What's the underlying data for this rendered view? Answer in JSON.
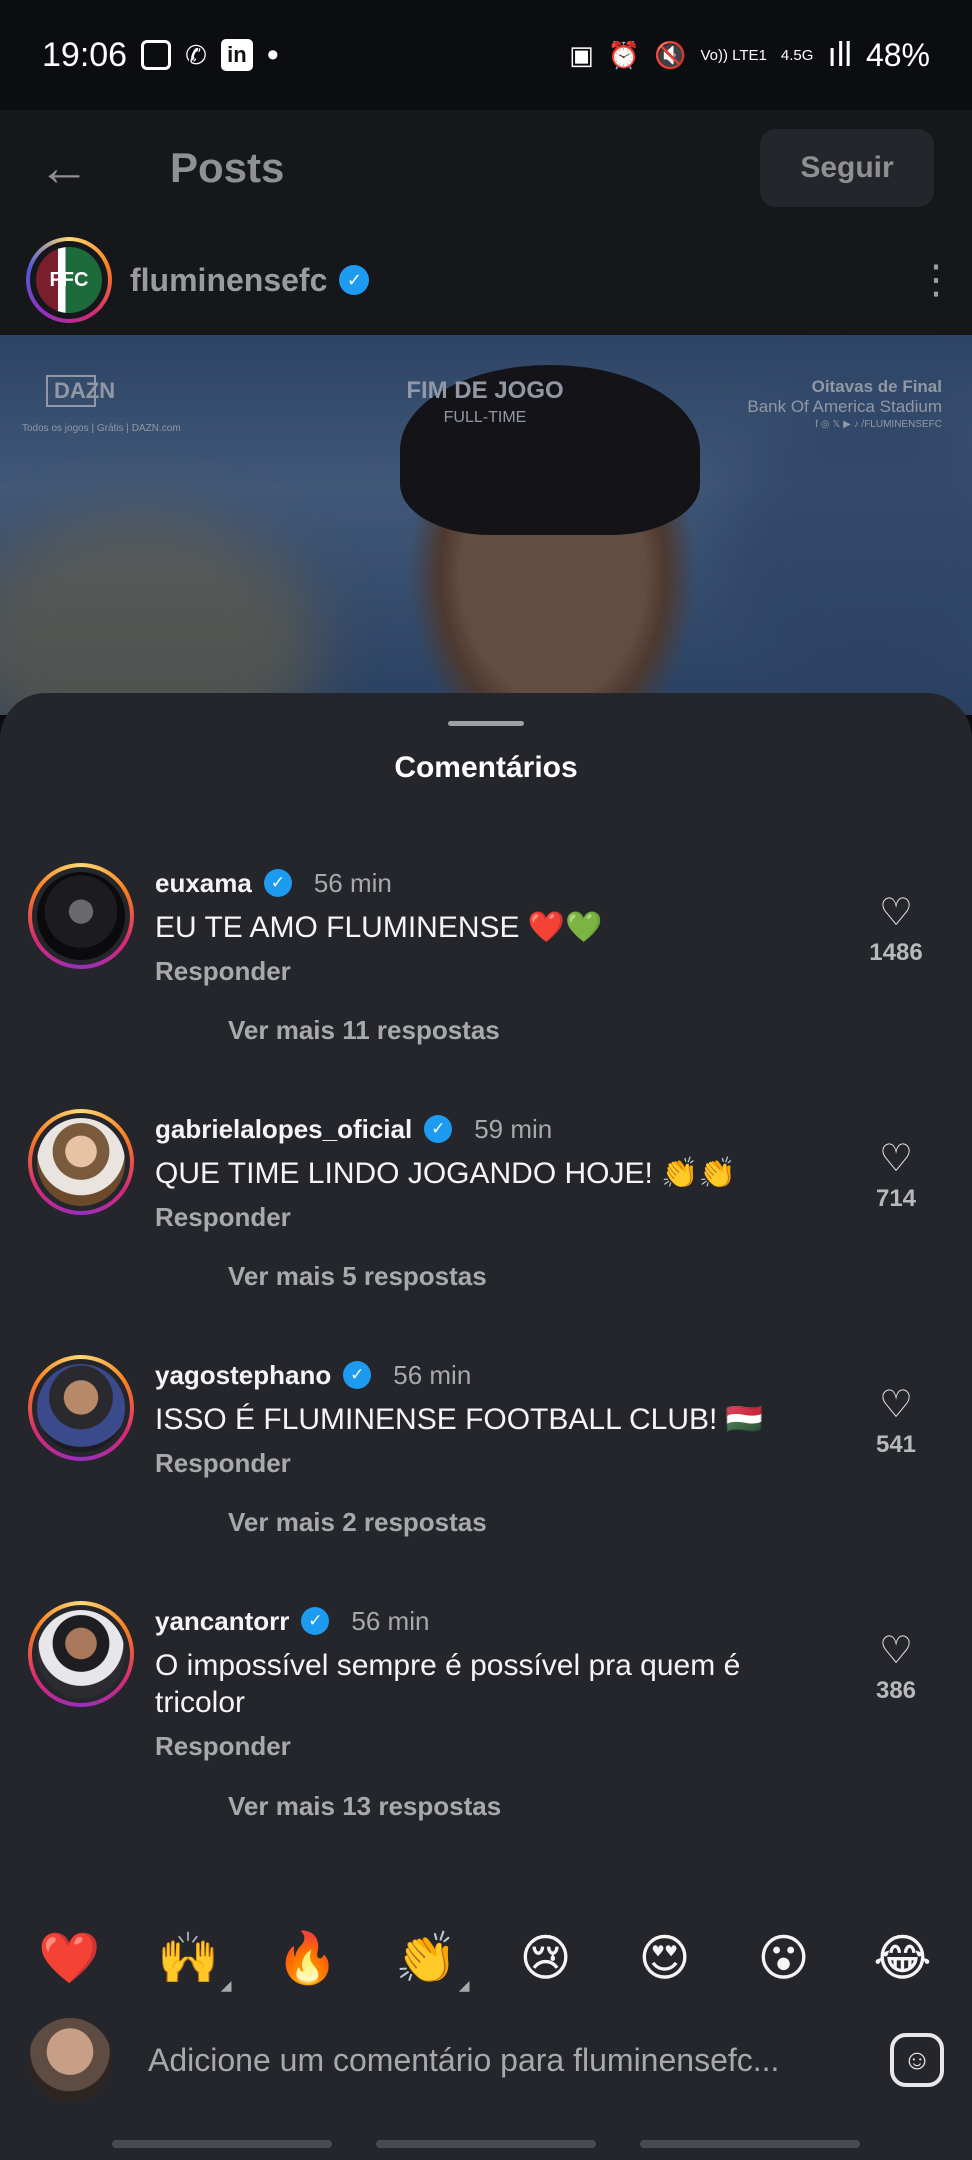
{
  "status_bar": {
    "time": "19:06",
    "dot": "•",
    "network": "Vo)) LTE1",
    "network_type": "4.5G",
    "signal": "ıll",
    "battery": "48%"
  },
  "nav": {
    "back_icon": "arrow-left",
    "title": "Posts",
    "follow_label": "Seguir"
  },
  "post": {
    "username": "fluminensefc",
    "verified": true,
    "image": {
      "top_center_title": "FIM DE JOGO",
      "top_center_sub": "FULL-TIME",
      "top_right_line1": "Oitavas de Final",
      "top_right_line2": "Bank Of America Stadium",
      "top_right_line3": "f ◎ 𝕏 ▶ ♪ /FLUMINENSEFC",
      "top_left_brand": "DAZN",
      "top_left_sub": "Todos os jogos | Grátis | DAZN.com"
    }
  },
  "sheet": {
    "title": "Comentários",
    "comments": [
      {
        "user": "euxama",
        "time": "56 min",
        "text": "EU TE AMO FLUMINENSE ❤️💚",
        "reply": "Responder",
        "more": "Ver mais 11 respostas",
        "likes": "1486"
      },
      {
        "user": "gabrielalopes_oficial",
        "time": "59 min",
        "text": "QUE TIME LINDO JOGANDO HOJE! 👏👏",
        "reply": "Responder",
        "more": "Ver mais 5 respostas",
        "likes": "714"
      },
      {
        "user": "yagostephano",
        "time": "56 min",
        "text": "ISSO É FLUMINENSE FOOTBALL CLUB! 🇭🇺",
        "reply": "Responder",
        "more": "Ver mais 2 respostas",
        "likes": "541"
      },
      {
        "user": "yancantorr",
        "time": "56 min",
        "text": "O impossível sempre é possível pra quem é tricolor",
        "reply": "Responder",
        "more": "Ver mais 13 respostas",
        "likes": "386"
      }
    ]
  },
  "reactions": [
    "❤️",
    "🙌",
    "🔥",
    "👏",
    "😢",
    "😍",
    "😮",
    "😂"
  ],
  "compose": {
    "placeholder": "Adicione um comentário para fluminensefc..."
  },
  "colors": {
    "sheet_bg": "#25262b",
    "verified": "#1d9bf0",
    "muted": "#a8a9ad"
  }
}
